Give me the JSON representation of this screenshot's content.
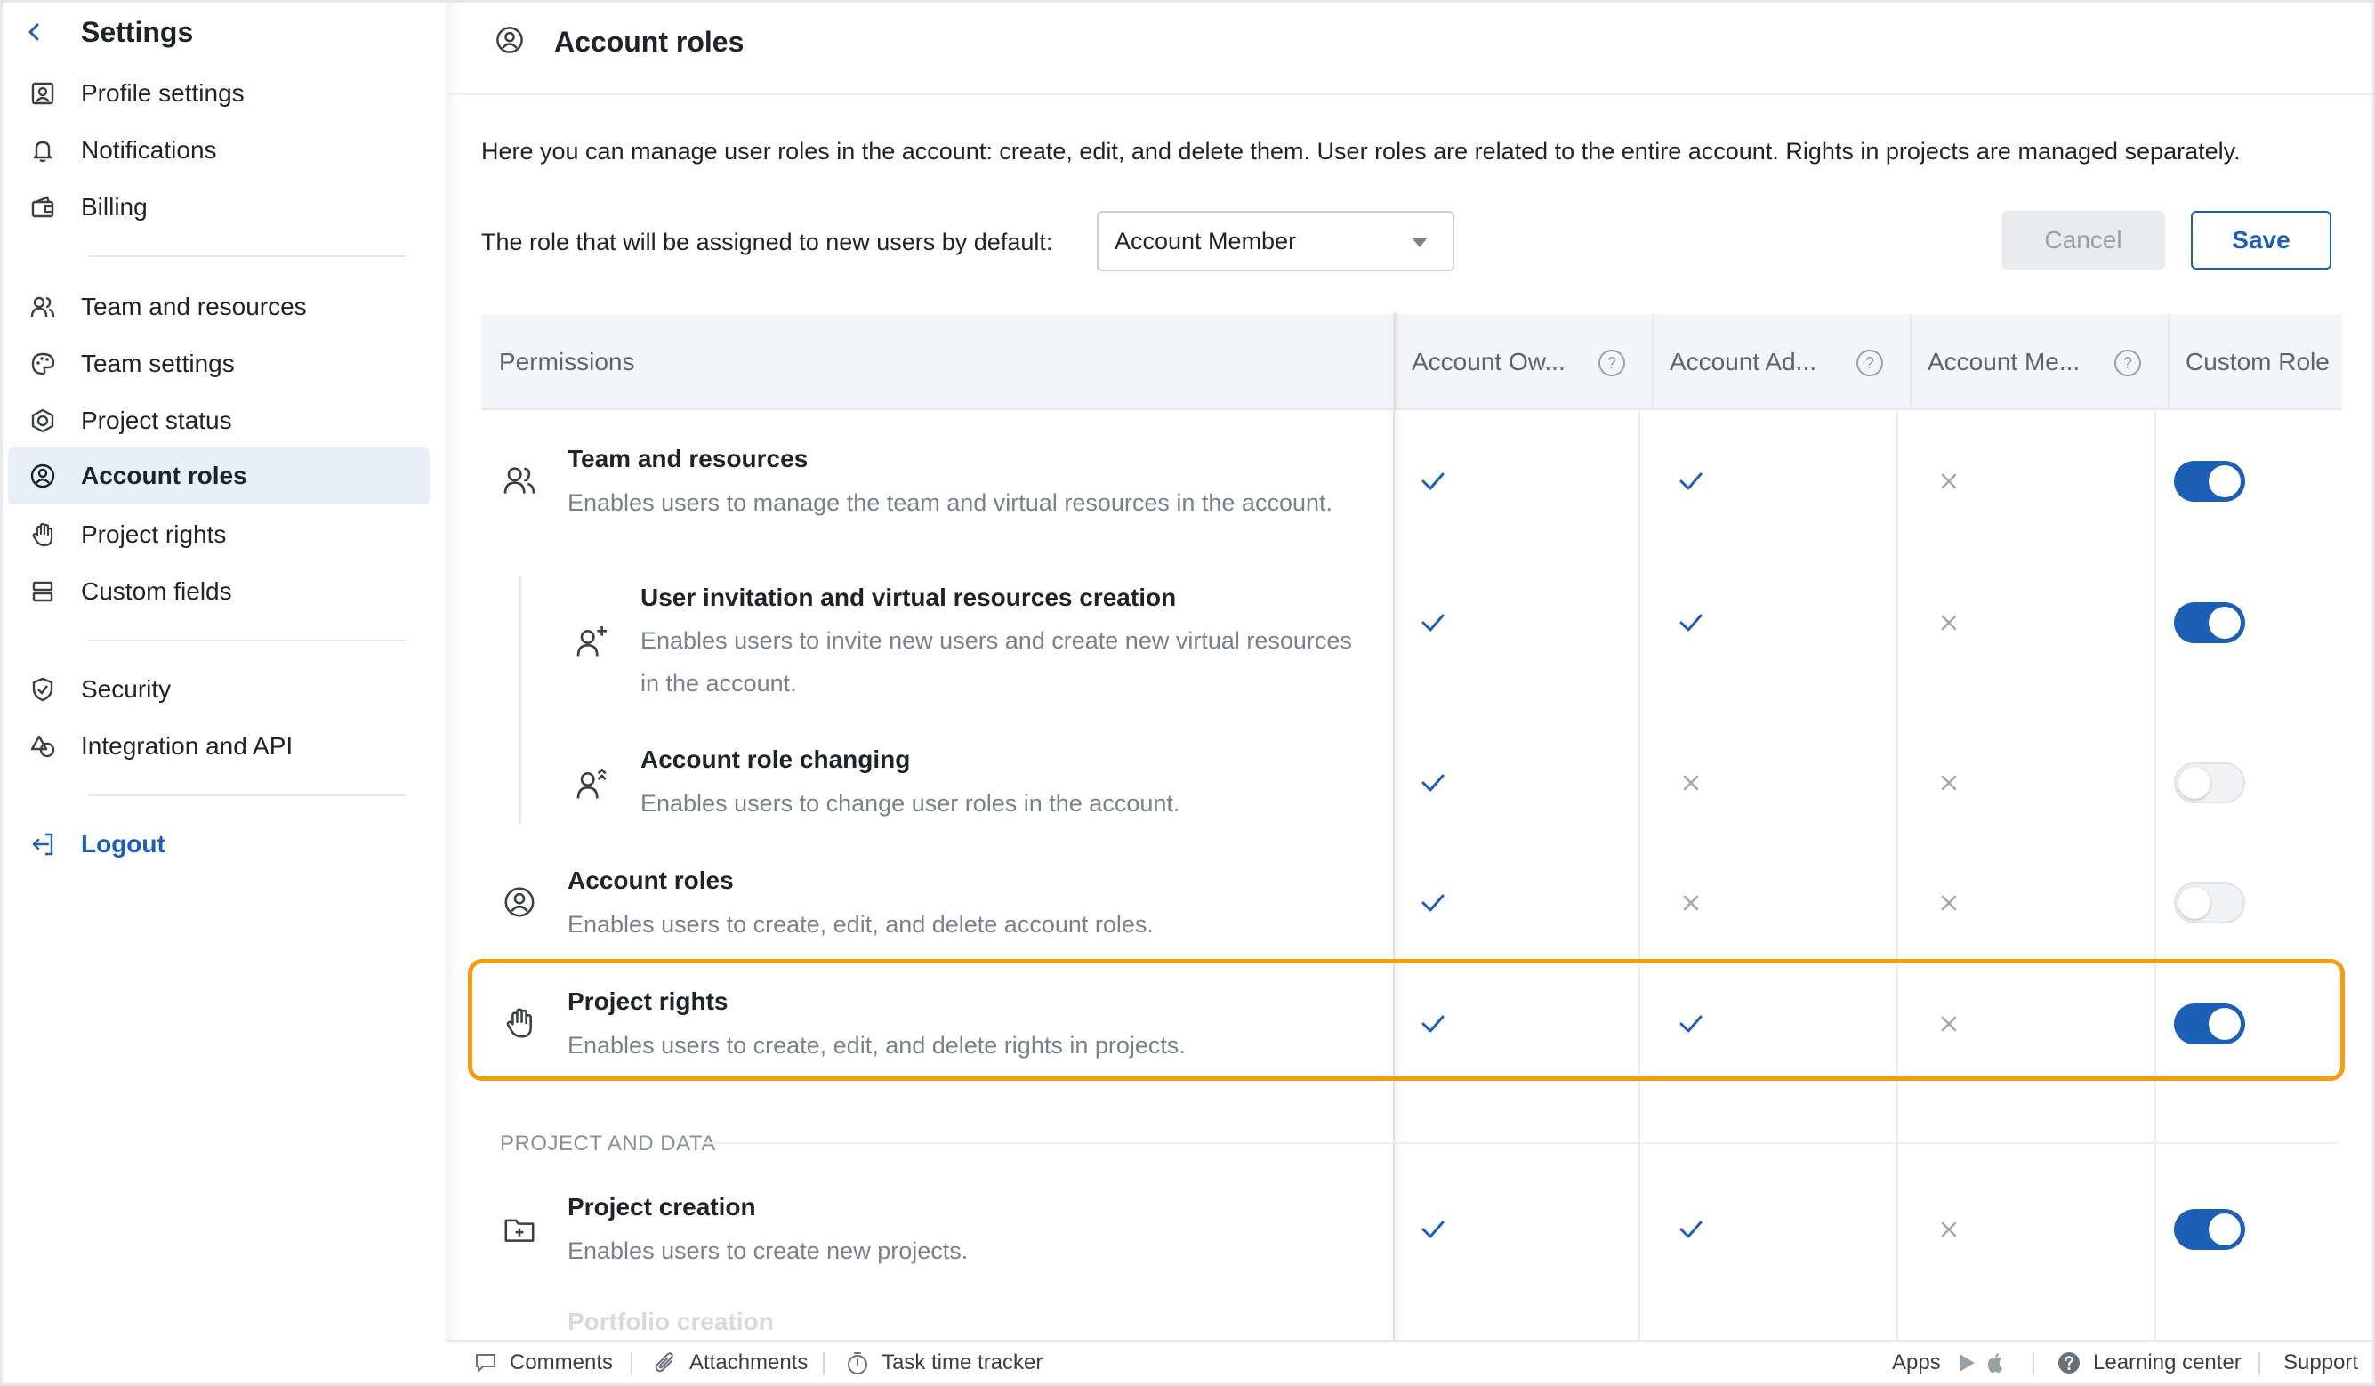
{
  "sidebar": {
    "title": "Settings",
    "items": [
      {
        "label": "Profile settings",
        "icon": "profile-icon"
      },
      {
        "label": "Notifications",
        "icon": "bell-icon"
      },
      {
        "label": "Billing",
        "icon": "wallet-icon"
      },
      {
        "label": "Team and resources",
        "icon": "users-icon"
      },
      {
        "label": "Team settings",
        "icon": "palette-icon"
      },
      {
        "label": "Project status",
        "icon": "status-icon"
      },
      {
        "label": "Account roles",
        "icon": "user-circle-icon",
        "active": true
      },
      {
        "label": "Project rights",
        "icon": "hand-icon"
      },
      {
        "label": "Custom fields",
        "icon": "fields-icon"
      },
      {
        "label": "Security",
        "icon": "shield-icon"
      },
      {
        "label": "Integration and API",
        "icon": "integration-icon"
      }
    ],
    "logout": "Logout"
  },
  "header": {
    "title": "Account roles"
  },
  "intro": "Here you can manage user roles in the account: create, edit, and delete them. User roles are related to the entire account. Rights in projects are managed separately.",
  "default_role": {
    "label": "The role that will be assigned to new users by default:",
    "value": "Account Member"
  },
  "buttons": {
    "cancel": "Cancel",
    "save": "Save"
  },
  "table": {
    "permissions_header": "Permissions",
    "columns": [
      "Account Ow...",
      "Account Ad...",
      "Account Me...",
      "Custom Role"
    ],
    "help_glyph": "?",
    "rows": [
      {
        "title": "Team and resources",
        "desc": "Enables users to manage the team and virtual resources in the account.",
        "icon": "users-icon",
        "values": [
          true,
          true,
          false
        ],
        "custom": true
      },
      {
        "title": "User invitation and virtual resources creation",
        "desc": "Enables users to invite new users and create new virtual resources in the account.",
        "icon": "user-plus-icon",
        "values": [
          true,
          true,
          false
        ],
        "custom": true
      },
      {
        "title": "Account role changing",
        "desc": "Enables users to change user roles in the account.",
        "icon": "user-role-change-icon",
        "values": [
          true,
          false,
          false
        ],
        "custom": false
      },
      {
        "title": "Account roles",
        "desc": "Enables users to create, edit, and delete account roles.",
        "icon": "user-circle-icon",
        "values": [
          true,
          false,
          false
        ],
        "custom": false
      },
      {
        "title": "Project rights",
        "desc": "Enables users to create, edit, and delete rights in projects.",
        "icon": "hand-icon",
        "values": [
          true,
          true,
          false
        ],
        "custom": true
      },
      {
        "title": "Project creation",
        "desc": "Enables users to create new projects.",
        "icon": "folder-plus-icon",
        "values": [
          true,
          true,
          false
        ],
        "custom": true
      }
    ],
    "section_label": "PROJECT AND DATA",
    "faded_row": "Portfolio creation"
  },
  "footer": {
    "comments": "Comments",
    "attachments": "Attachments",
    "time_tracker": "Task time tracker",
    "apps": "Apps",
    "learning": "Learning center",
    "support": "Support"
  },
  "colors": {
    "accent": "#1b5fb6",
    "highlight": "#f59c0f",
    "active_bg": "#e9eff8"
  }
}
